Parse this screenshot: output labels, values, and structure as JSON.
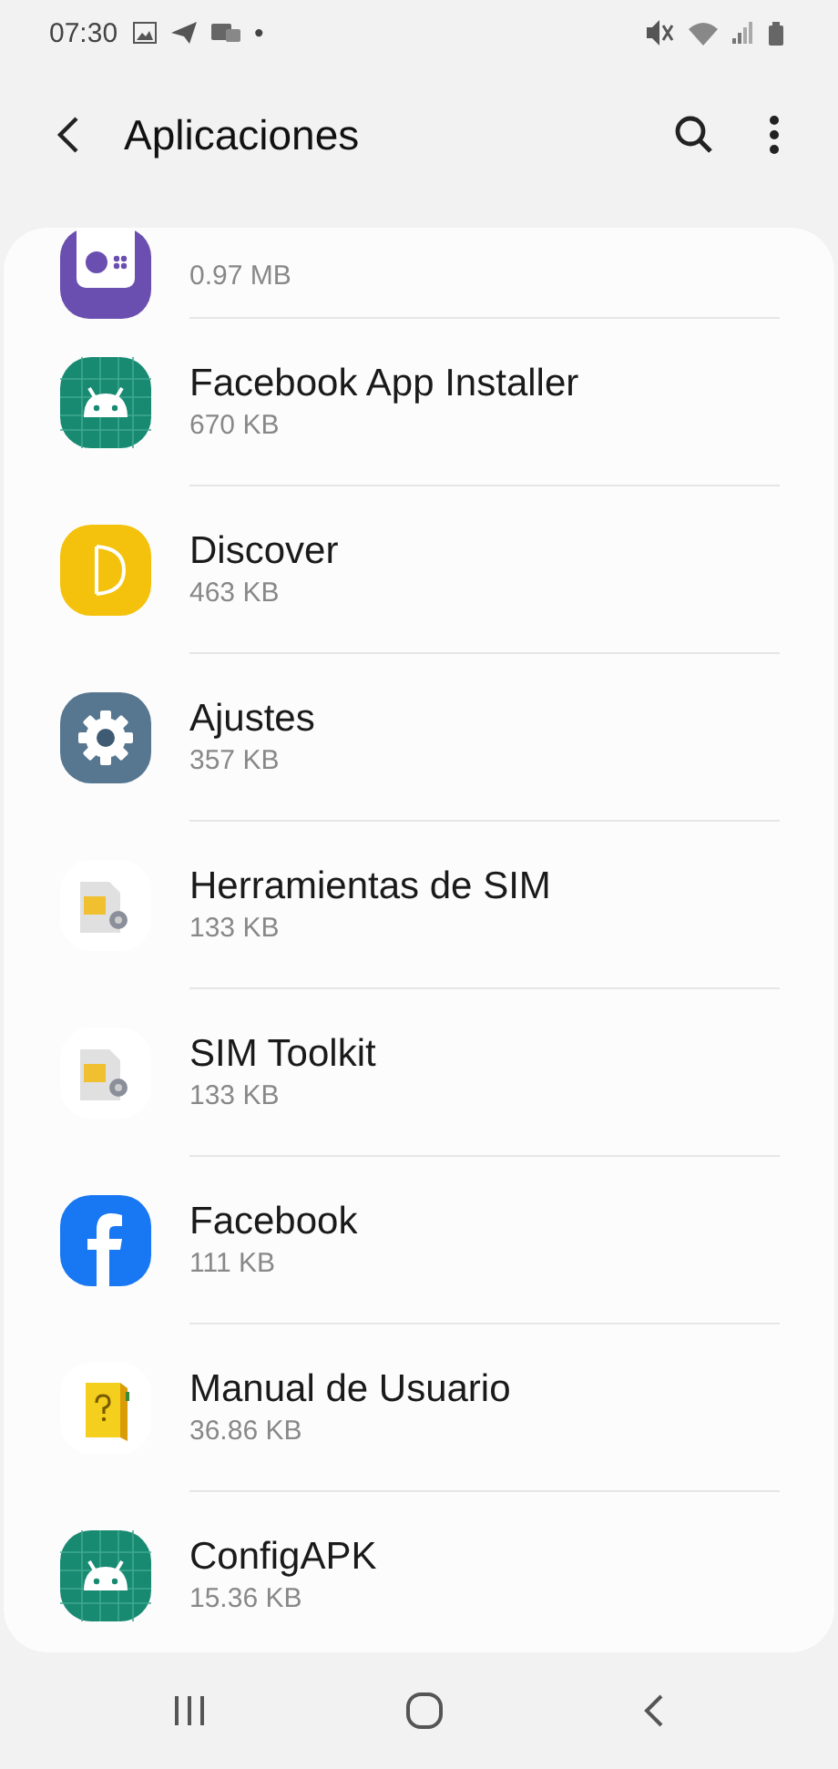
{
  "status_bar": {
    "time": "07:30",
    "dot": "•"
  },
  "header": {
    "title": "Aplicaciones"
  },
  "apps": [
    {
      "kind": "radio",
      "size": "0.97 MB"
    },
    {
      "kind": "android",
      "name": "Facebook App Installer",
      "size": "670 KB"
    },
    {
      "kind": "discover",
      "name": "Discover",
      "size": "463 KB"
    },
    {
      "kind": "gear",
      "name": "Ajustes",
      "size": "357 KB"
    },
    {
      "kind": "sim",
      "name": "Herramientas de SIM",
      "size": "133 KB"
    },
    {
      "kind": "sim",
      "name": "SIM Toolkit",
      "size": "133 KB"
    },
    {
      "kind": "facebook",
      "name": "Facebook",
      "size": "111 KB"
    },
    {
      "kind": "manual",
      "name": "Manual de Usuario",
      "size": "36.86 KB"
    },
    {
      "kind": "android",
      "name": "ConfigAPK",
      "size": "15.36 KB"
    }
  ]
}
